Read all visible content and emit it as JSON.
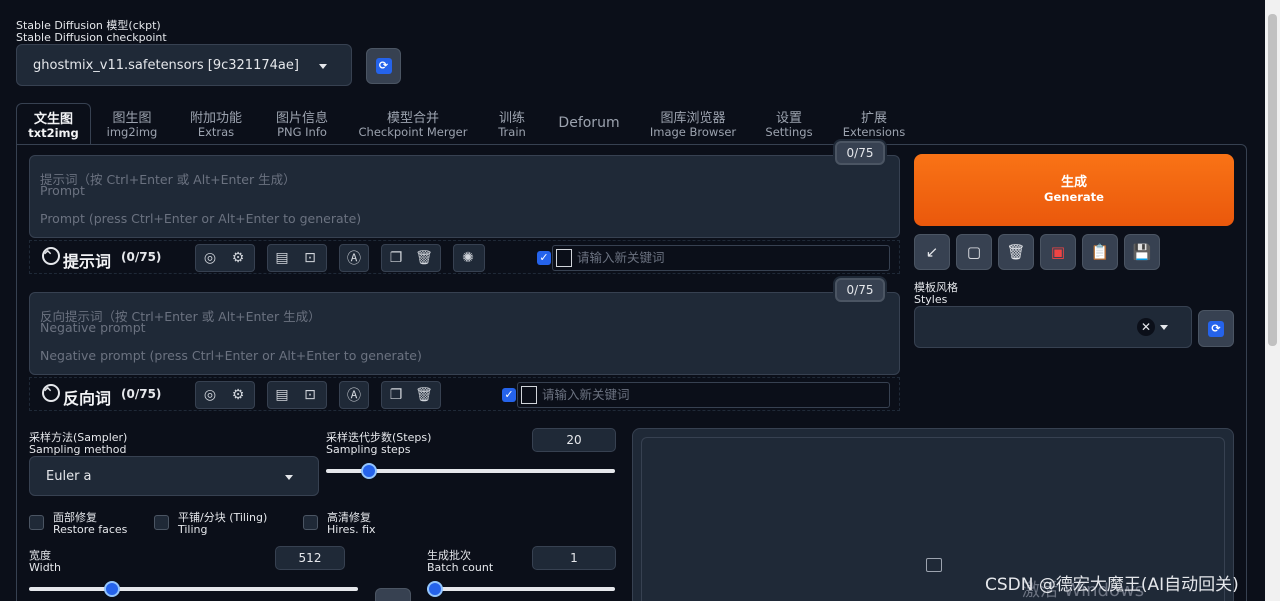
{
  "checkpoint": {
    "label_cn": "Stable Diffusion 模型(ckpt)",
    "label_en": "Stable Diffusion checkpoint",
    "value": "ghostmix_v11.safetensors [9c321174ae]"
  },
  "tabs": [
    {
      "cn": "文生图",
      "en": "txt2img"
    },
    {
      "cn": "图生图",
      "en": "img2img"
    },
    {
      "cn": "附加功能",
      "en": "Extras"
    },
    {
      "cn": "图片信息",
      "en": "PNG Info"
    },
    {
      "cn": "模型合并",
      "en": "Checkpoint Merger"
    },
    {
      "cn": "训练",
      "en": "Train"
    },
    {
      "cn": "Deforum",
      "en": ""
    },
    {
      "cn": "图库浏览器",
      "en": "Image Browser"
    },
    {
      "cn": "设置",
      "en": "Settings"
    },
    {
      "cn": "扩展",
      "en": "Extensions"
    }
  ],
  "prompt": {
    "placeholder_cn": "提示词（按 Ctrl+Enter 或 Alt+Enter 生成）",
    "placeholder_en": "Prompt",
    "placeholder_hint": "Prompt (press Ctrl+Enter or Alt+Enter to generate)",
    "counter": "0/75",
    "toolbar_title": "提示词",
    "toolbar_count": "(0/75)",
    "keyword_placeholder": "请输入新关键词"
  },
  "negative": {
    "placeholder_cn": "反向提示词（按 Ctrl+Enter 或 Alt+Enter 生成）",
    "placeholder_en": "Negative prompt",
    "placeholder_hint": "Negative prompt (press Ctrl+Enter or Alt+Enter to generate)",
    "counter": "0/75",
    "toolbar_title": "反向词",
    "toolbar_count": "(0/75)",
    "keyword_placeholder": "请输入新关键词"
  },
  "generate": {
    "cn": "生成",
    "en": "Generate"
  },
  "styles": {
    "label_cn": "模板风格",
    "label_en": "Styles"
  },
  "sampler": {
    "label_cn": "采样方法(Sampler)",
    "label_en": "Sampling method",
    "value": "Euler a"
  },
  "steps": {
    "label_cn": "采样迭代步数(Steps)",
    "label_en": "Sampling steps",
    "value": "20",
    "fraction": 0.13
  },
  "checks": [
    {
      "cn": "面部修复",
      "en": "Restore faces"
    },
    {
      "cn": "平铺/分块 (Tiling)",
      "en": "Tiling"
    },
    {
      "cn": "高清修复",
      "en": "Hires. fix"
    }
  ],
  "width": {
    "label_cn": "宽度",
    "label_en": "Width",
    "value": "512",
    "fraction": 0.24
  },
  "batch": {
    "label_cn": "生成批次",
    "label_en": "Batch count",
    "value": "1",
    "fraction": 0.0
  },
  "watermark": "CSDN @德宏大魔王(AI自动回关)",
  "activate": "激活 Windows"
}
